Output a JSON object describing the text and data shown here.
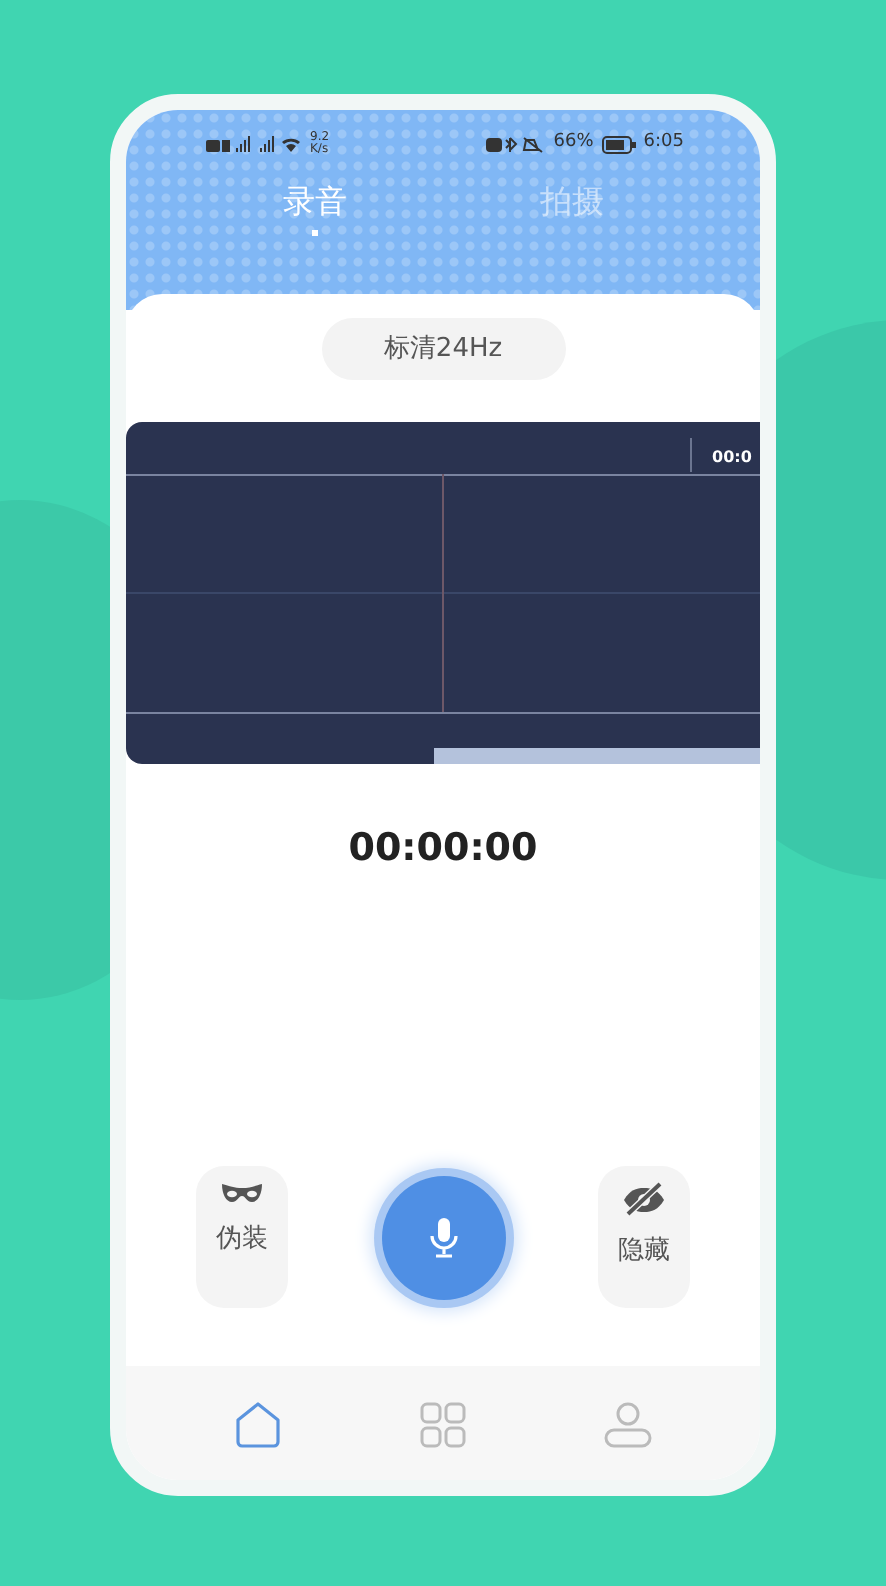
{
  "status_bar": {
    "net_speed": "9.2",
    "net_unit": "K/s",
    "battery": "66%",
    "time": "6:05"
  },
  "tabs": [
    {
      "label": "录音",
      "selected": true
    },
    {
      "label": "拍摄",
      "selected": false
    }
  ],
  "quality": "标清24Hz",
  "waveform": {
    "time_label": "00:0"
  },
  "timer": "00:00:00",
  "actions": [
    {
      "kind": "disguise",
      "label": "伪装"
    },
    {
      "kind": "record"
    },
    {
      "kind": "hide",
      "label": "隐藏"
    }
  ],
  "nav": [
    {
      "kind": "home",
      "selected": true
    },
    {
      "kind": "apps",
      "selected": false
    },
    {
      "kind": "profile",
      "selected": false
    }
  ]
}
